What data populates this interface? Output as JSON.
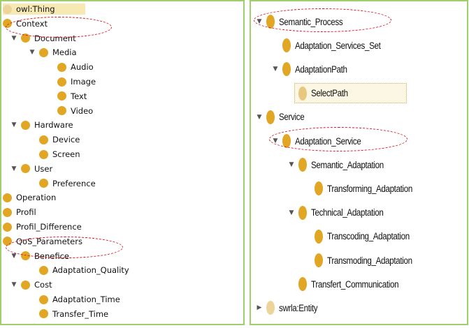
{
  "left_tree": [
    {
      "label": "owl:Thing",
      "depth": 0,
      "toggle": "none",
      "style": "pale"
    },
    {
      "label": "Context",
      "depth": 0,
      "toggle": "expanded"
    },
    {
      "label": "Document",
      "depth": 1,
      "toggle": "expanded"
    },
    {
      "label": "Media",
      "depth": 2,
      "toggle": "expanded"
    },
    {
      "label": "Audio",
      "depth": 3,
      "toggle": "none"
    },
    {
      "label": "Image",
      "depth": 3,
      "toggle": "none"
    },
    {
      "label": "Text",
      "depth": 3,
      "toggle": "none"
    },
    {
      "label": "Video",
      "depth": 3,
      "toggle": "none"
    },
    {
      "label": "Hardware",
      "depth": 1,
      "toggle": "expanded"
    },
    {
      "label": "Device",
      "depth": 2,
      "toggle": "none"
    },
    {
      "label": "Screen",
      "depth": 2,
      "toggle": "none"
    },
    {
      "label": "User",
      "depth": 1,
      "toggle": "expanded"
    },
    {
      "label": "Preference",
      "depth": 2,
      "toggle": "none"
    },
    {
      "label": "Operation",
      "depth": 0,
      "toggle": "none"
    },
    {
      "label": "Profil",
      "depth": 0,
      "toggle": "none"
    },
    {
      "label": "Profil_Difference",
      "depth": 0,
      "toggle": "none"
    },
    {
      "label": "QoS_Parameters",
      "depth": 0,
      "toggle": "expanded"
    },
    {
      "label": "Benefice",
      "depth": 1,
      "toggle": "expanded"
    },
    {
      "label": "Adaptation_Quality",
      "depth": 2,
      "toggle": "none"
    },
    {
      "label": "Cost",
      "depth": 1,
      "toggle": "expanded"
    },
    {
      "label": "Adaptation_Time",
      "depth": 2,
      "toggle": "none"
    },
    {
      "label": "Transfer_Time",
      "depth": 2,
      "toggle": "none"
    }
  ],
  "right_tree": [
    {
      "label": "Semantic_Process",
      "depth": 0,
      "toggle": "expanded"
    },
    {
      "label": "Adaptation_Services_Set",
      "depth": 1,
      "toggle": "none"
    },
    {
      "label": "AdaptationPath",
      "depth": 1,
      "toggle": "expanded"
    },
    {
      "label": "SelectPath",
      "depth": 2,
      "toggle": "none",
      "style": "selected"
    },
    {
      "label": "Service",
      "depth": 0,
      "toggle": "expanded"
    },
    {
      "label": "Adaptation_Service",
      "depth": 1,
      "toggle": "expanded"
    },
    {
      "label": "Semantic_Adaptation",
      "depth": 2,
      "toggle": "expanded"
    },
    {
      "label": "Transforming_Adaptation",
      "depth": 3,
      "toggle": "none"
    },
    {
      "label": "Technical_Adaptation",
      "depth": 2,
      "toggle": "expanded"
    },
    {
      "label": "Transcoding_Adaptation",
      "depth": 3,
      "toggle": "none"
    },
    {
      "label": "Transmoding_Adaptation",
      "depth": 3,
      "toggle": "none"
    },
    {
      "label": "Transfert_Communication",
      "depth": 2,
      "toggle": "none"
    },
    {
      "label": "swrla:Entity",
      "depth": 0,
      "toggle": "collapsed",
      "style": "pale"
    }
  ],
  "colors": {
    "class_dot": "#e0a624",
    "pale_dot": "#ecd49a",
    "highlight": "#d9101a",
    "panel_border": "#9fcf6a"
  },
  "icons": {
    "expanded": "triangle-down-icon",
    "collapsed": "triangle-right-icon",
    "class": "class-dot-icon"
  }
}
